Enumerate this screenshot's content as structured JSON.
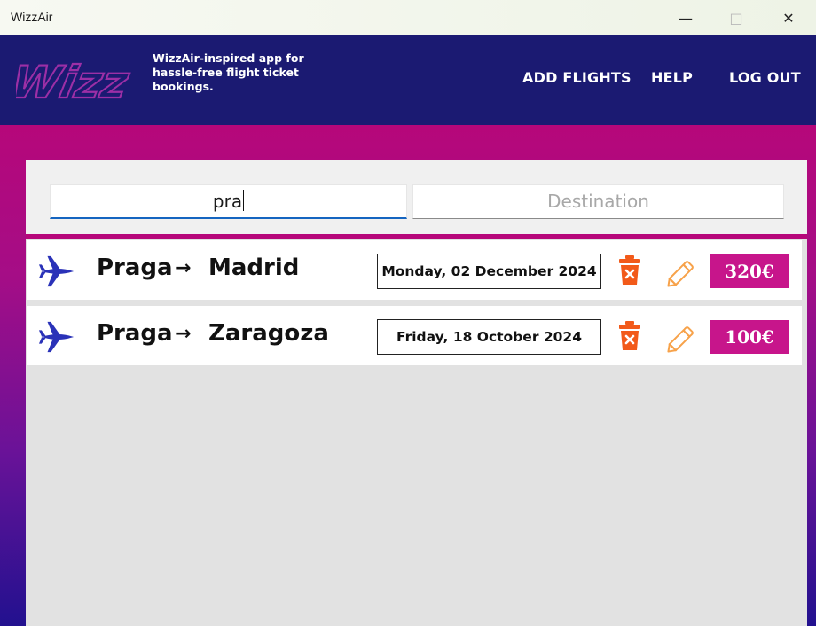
{
  "window": {
    "title": "WizzAir"
  },
  "header": {
    "logo_text": "Wizz",
    "tagline": "WizzAir-inspired app for hassle-free flight ticket bookings.",
    "nav": [
      {
        "label": "ADD FLIGHTS"
      },
      {
        "label": "HELP"
      },
      {
        "label": "LOG OUT"
      }
    ]
  },
  "search": {
    "origin_value": "pra",
    "destination_placeholder": "Destination"
  },
  "flights": [
    {
      "origin": "Praga",
      "arrow": "→",
      "destination": "Madrid",
      "date": "Monday, 02 December 2024",
      "price": "320€"
    },
    {
      "origin": "Praga",
      "arrow": "→",
      "destination": "Zaragoza",
      "date": "Friday, 18 October 2024",
      "price": "100€"
    }
  ],
  "colors": {
    "header": "#1b1a72",
    "accent": "#c7158b",
    "gradient_top": "#b6077a",
    "gradient_bottom": "#22118f",
    "delete": "#f25a1a",
    "edit": "#f7a24a",
    "plane": "#2a32b8"
  }
}
